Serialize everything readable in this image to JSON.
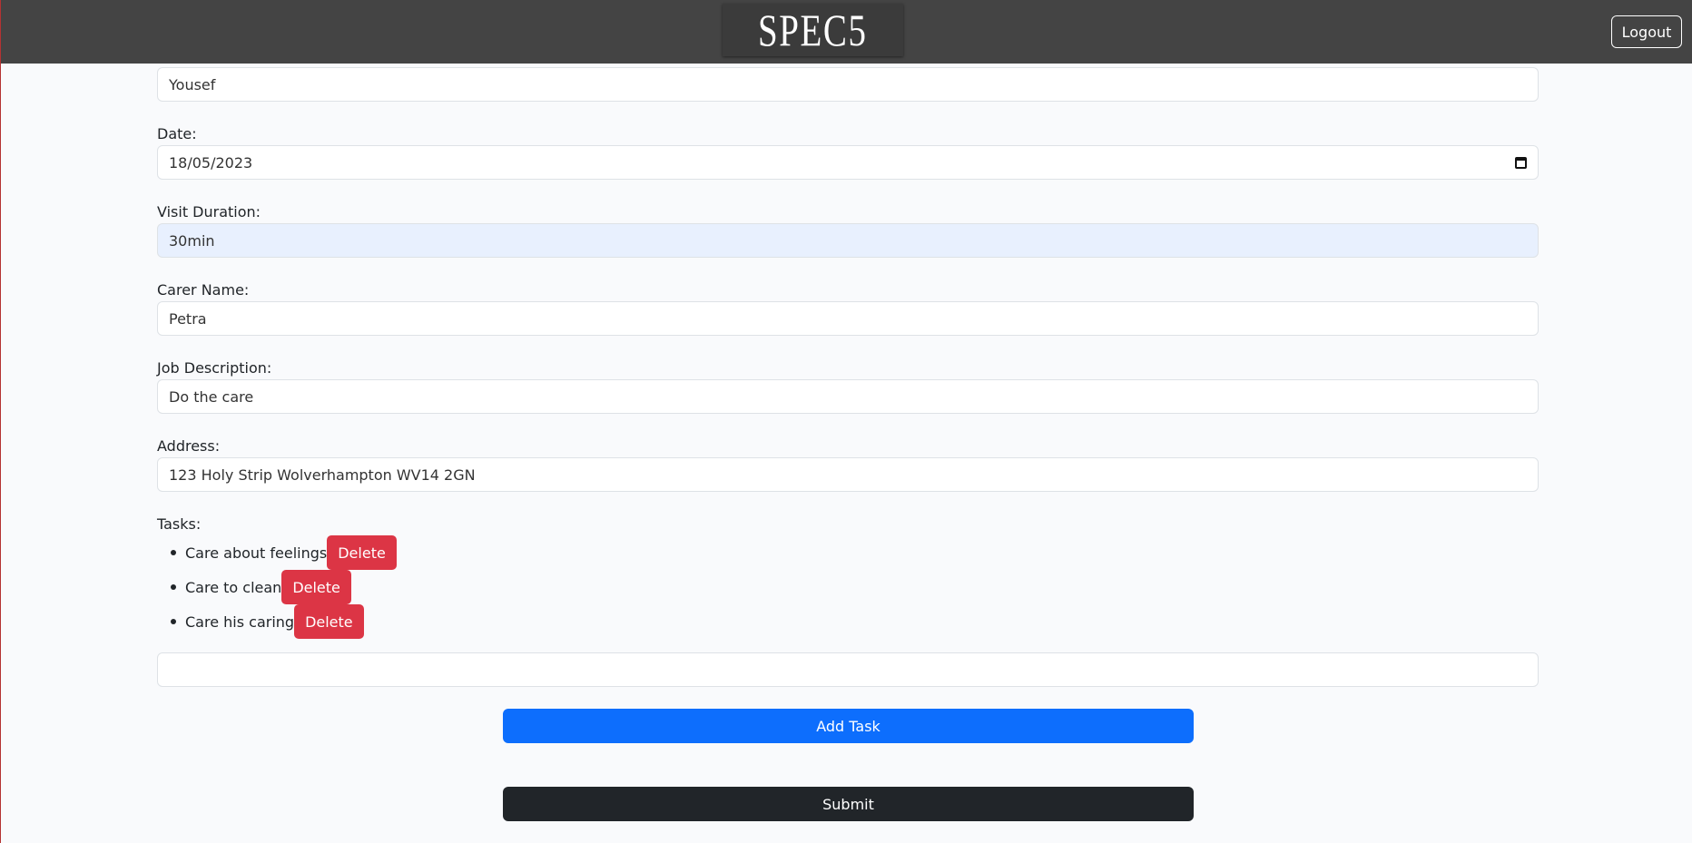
{
  "header": {
    "brand": "SPEC5",
    "logout_label": "Logout"
  },
  "form": {
    "client_name": {
      "value": "Yousef"
    },
    "date": {
      "label": "Date:",
      "value": "18/05/2023"
    },
    "visit_duration": {
      "label": "Visit Duration:",
      "value": "30min"
    },
    "carer_name": {
      "label": "Carer Name:",
      "value": "Petra"
    },
    "job_description": {
      "label": "Job Description:",
      "value": "Do the care"
    },
    "address": {
      "label": "Address:",
      "value": "123 Holy Strip Wolverhampton WV14 2GN"
    },
    "tasks_label": "Tasks:",
    "tasks": [
      {
        "text": "Care about feelings",
        "delete_label": "Delete"
      },
      {
        "text": "Care to clean",
        "delete_label": "Delete"
      },
      {
        "text": "Care his caring",
        "delete_label": "Delete"
      }
    ],
    "new_task": {
      "value": ""
    },
    "add_task_label": "Add Task",
    "submit_label": "Submit"
  },
  "colors": {
    "navbar": "#444444",
    "danger": "#dc3545",
    "primary": "#0d6efd",
    "dark": "#212529",
    "autofill": "#e8f0fe"
  },
  "icons": {
    "date_picker": "calendar-icon"
  }
}
